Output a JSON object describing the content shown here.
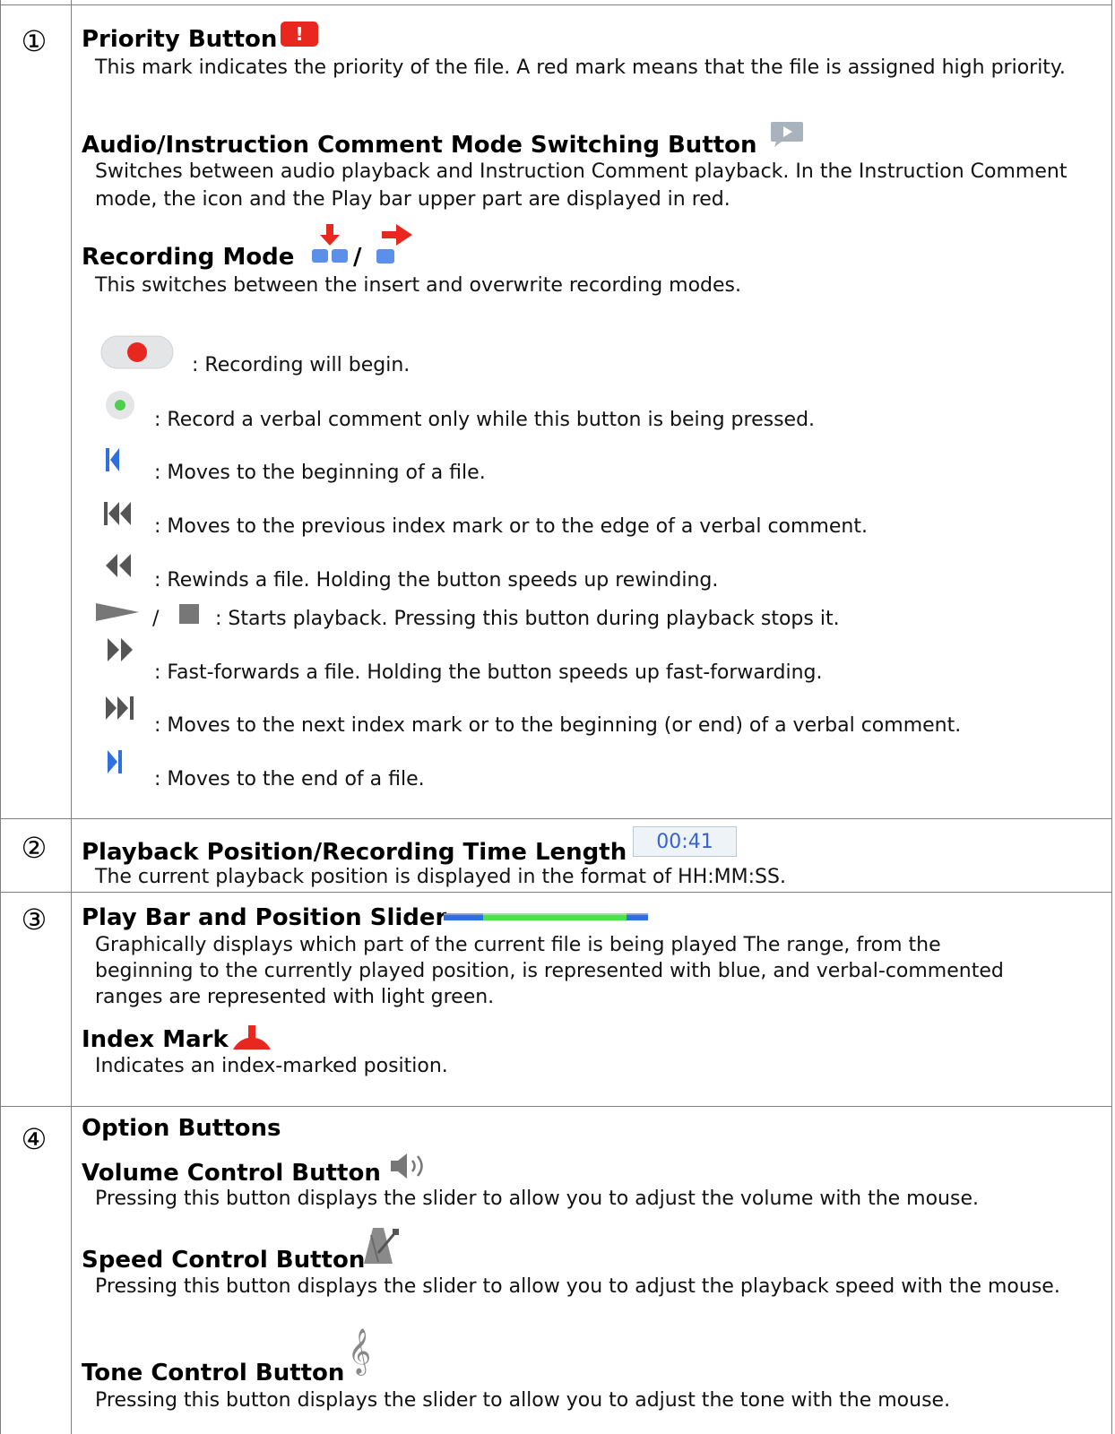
{
  "rows": [
    {
      "num": "①",
      "priority": {
        "title": "Priority Button",
        "icon_text": "!",
        "desc": "This mark indicates the priority of the file. A red mark means that the file is assigned high priority."
      },
      "audio_mode": {
        "title": "Audio/Instruction Comment Mode Switching Button",
        "desc": "Switches between audio playback and Instruction Comment playback. In the Instruction Comment mode, the icon and the Play bar upper part are displayed in red."
      },
      "recording_mode": {
        "title": "Recording Mode",
        "sep": "/",
        "desc": "This switches between the insert and overwrite recording modes."
      },
      "buttons": [
        {
          "icon": "record-button-icon",
          "desc": ": Recording will begin."
        },
        {
          "icon": "verbal-comment-button-icon",
          "desc": ": Record a verbal comment only while this button is being pressed."
        },
        {
          "icon": "skip-to-start-icon",
          "desc": ": Moves to the beginning of a file."
        },
        {
          "icon": "previous-index-icon",
          "desc": ": Moves to the previous index mark or to the edge of a verbal comment."
        },
        {
          "icon": "rewind-icon",
          "desc": ": Rewinds a file. Holding the button speeds up rewinding."
        },
        {
          "icon": "play-stop-icon",
          "sep": "/",
          "desc": ": Starts playback. Pressing this button during playback stops it."
        },
        {
          "icon": "fast-forward-icon",
          "desc": ": Fast-forwards a file. Holding the button speeds up fast-forwarding."
        },
        {
          "icon": "next-index-icon",
          "desc": ": Moves to the next index mark or to the beginning (or end) of a verbal comment."
        },
        {
          "icon": "skip-to-end-icon",
          "desc": ": Moves to the end of a file."
        }
      ]
    },
    {
      "num": "②",
      "title": "Playback Position/Recording Time Length",
      "time": "00:41",
      "desc": "The current playback position is displayed in the format of HH:MM:SS."
    },
    {
      "num": "③",
      "title": "Play Bar and Position Slider",
      "desc": "Graphically displays which part of the current file is being played The range, from the beginning to the currently played position, is represented with blue, and verbal-commented ranges are represented with light green.",
      "index_title": "Index Mark",
      "index_desc": "Indicates an index-marked position."
    },
    {
      "num": "④",
      "title": "Option Buttons",
      "volume_title": "Volume Control Button",
      "volume_desc": "Pressing this button displays the slider to allow you to adjust the volume with the mouse.",
      "speed_title": "Speed Control Button",
      "speed_desc": "Pressing this button displays the slider to allow you to adjust the playback speed with the mouse.",
      "tone_title": "Tone Control Button",
      "tone_desc": "Pressing this button displays the slider to allow you to adjust the tone with the mouse."
    }
  ],
  "colors": {
    "border": "#808080",
    "red": "#e8281e",
    "blue_icon": "#5b8fe8",
    "bar_blue": "#2f6fe0",
    "bar_green": "#4ce24c",
    "time_text": "#3a62c8"
  }
}
